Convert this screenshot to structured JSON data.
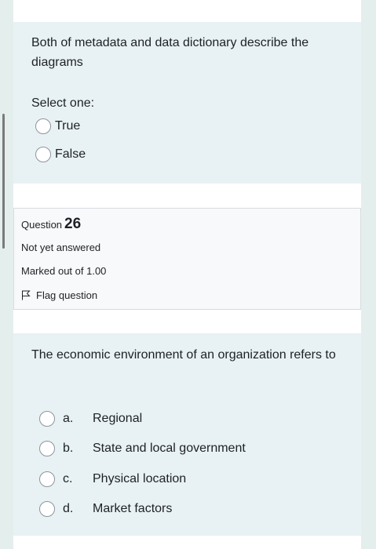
{
  "question_25": {
    "text": "Both of metadata and data dictionary describe the diagrams",
    "prompt": "Select one:",
    "options": [
      {
        "label": "True"
      },
      {
        "label": "False"
      }
    ]
  },
  "question_26_info": {
    "question_label": "Question",
    "question_number": "26",
    "status": "Not yet answered",
    "marked_out_of": "Marked out of 1.00",
    "flag_label": "Flag question"
  },
  "question_26": {
    "text": "The economic environment of an organization refers to",
    "options": [
      {
        "letter": "a.",
        "label": "Regional"
      },
      {
        "letter": "b.",
        "label": "State and local government"
      },
      {
        "letter": "c.",
        "label": "Physical location"
      },
      {
        "letter": "d.",
        "label": "Market factors"
      }
    ]
  },
  "colors": {
    "page_background": "#e4efed",
    "formulation_background": "#e8f1f3",
    "info_background": "#f8f9fa",
    "text": "#1d2125"
  }
}
